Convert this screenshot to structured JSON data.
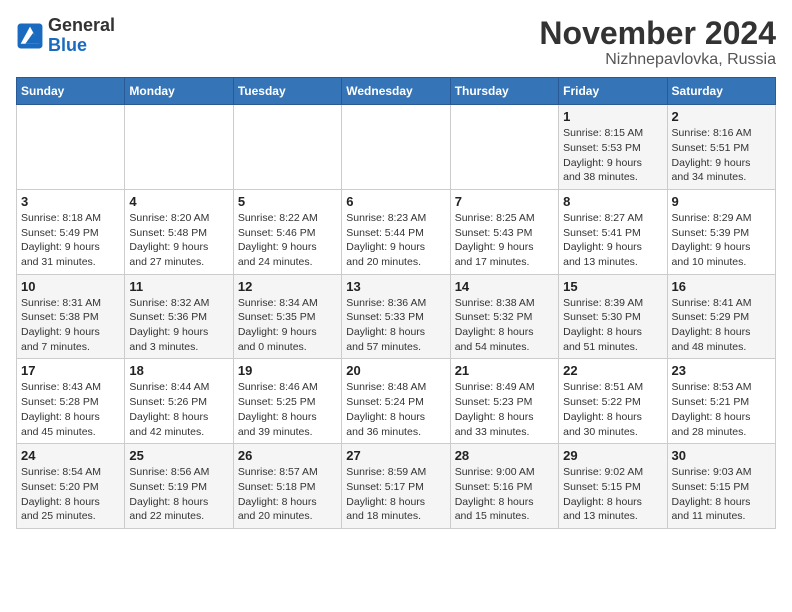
{
  "header": {
    "logo": {
      "general": "General",
      "blue": "Blue"
    },
    "title": "November 2024",
    "subtitle": "Nizhnepavlovka, Russia"
  },
  "calendar": {
    "weekdays": [
      "Sunday",
      "Monday",
      "Tuesday",
      "Wednesday",
      "Thursday",
      "Friday",
      "Saturday"
    ],
    "weeks": [
      [
        {
          "day": "",
          "info": ""
        },
        {
          "day": "",
          "info": ""
        },
        {
          "day": "",
          "info": ""
        },
        {
          "day": "",
          "info": ""
        },
        {
          "day": "",
          "info": ""
        },
        {
          "day": "1",
          "info": "Sunrise: 8:15 AM\nSunset: 5:53 PM\nDaylight: 9 hours\nand 38 minutes."
        },
        {
          "day": "2",
          "info": "Sunrise: 8:16 AM\nSunset: 5:51 PM\nDaylight: 9 hours\nand 34 minutes."
        }
      ],
      [
        {
          "day": "3",
          "info": "Sunrise: 8:18 AM\nSunset: 5:49 PM\nDaylight: 9 hours\nand 31 minutes."
        },
        {
          "day": "4",
          "info": "Sunrise: 8:20 AM\nSunset: 5:48 PM\nDaylight: 9 hours\nand 27 minutes."
        },
        {
          "day": "5",
          "info": "Sunrise: 8:22 AM\nSunset: 5:46 PM\nDaylight: 9 hours\nand 24 minutes."
        },
        {
          "day": "6",
          "info": "Sunrise: 8:23 AM\nSunset: 5:44 PM\nDaylight: 9 hours\nand 20 minutes."
        },
        {
          "day": "7",
          "info": "Sunrise: 8:25 AM\nSunset: 5:43 PM\nDaylight: 9 hours\nand 17 minutes."
        },
        {
          "day": "8",
          "info": "Sunrise: 8:27 AM\nSunset: 5:41 PM\nDaylight: 9 hours\nand 13 minutes."
        },
        {
          "day": "9",
          "info": "Sunrise: 8:29 AM\nSunset: 5:39 PM\nDaylight: 9 hours\nand 10 minutes."
        }
      ],
      [
        {
          "day": "10",
          "info": "Sunrise: 8:31 AM\nSunset: 5:38 PM\nDaylight: 9 hours\nand 7 minutes."
        },
        {
          "day": "11",
          "info": "Sunrise: 8:32 AM\nSunset: 5:36 PM\nDaylight: 9 hours\nand 3 minutes."
        },
        {
          "day": "12",
          "info": "Sunrise: 8:34 AM\nSunset: 5:35 PM\nDaylight: 9 hours\nand 0 minutes."
        },
        {
          "day": "13",
          "info": "Sunrise: 8:36 AM\nSunset: 5:33 PM\nDaylight: 8 hours\nand 57 minutes."
        },
        {
          "day": "14",
          "info": "Sunrise: 8:38 AM\nSunset: 5:32 PM\nDaylight: 8 hours\nand 54 minutes."
        },
        {
          "day": "15",
          "info": "Sunrise: 8:39 AM\nSunset: 5:30 PM\nDaylight: 8 hours\nand 51 minutes."
        },
        {
          "day": "16",
          "info": "Sunrise: 8:41 AM\nSunset: 5:29 PM\nDaylight: 8 hours\nand 48 minutes."
        }
      ],
      [
        {
          "day": "17",
          "info": "Sunrise: 8:43 AM\nSunset: 5:28 PM\nDaylight: 8 hours\nand 45 minutes."
        },
        {
          "day": "18",
          "info": "Sunrise: 8:44 AM\nSunset: 5:26 PM\nDaylight: 8 hours\nand 42 minutes."
        },
        {
          "day": "19",
          "info": "Sunrise: 8:46 AM\nSunset: 5:25 PM\nDaylight: 8 hours\nand 39 minutes."
        },
        {
          "day": "20",
          "info": "Sunrise: 8:48 AM\nSunset: 5:24 PM\nDaylight: 8 hours\nand 36 minutes."
        },
        {
          "day": "21",
          "info": "Sunrise: 8:49 AM\nSunset: 5:23 PM\nDaylight: 8 hours\nand 33 minutes."
        },
        {
          "day": "22",
          "info": "Sunrise: 8:51 AM\nSunset: 5:22 PM\nDaylight: 8 hours\nand 30 minutes."
        },
        {
          "day": "23",
          "info": "Sunrise: 8:53 AM\nSunset: 5:21 PM\nDaylight: 8 hours\nand 28 minutes."
        }
      ],
      [
        {
          "day": "24",
          "info": "Sunrise: 8:54 AM\nSunset: 5:20 PM\nDaylight: 8 hours\nand 25 minutes."
        },
        {
          "day": "25",
          "info": "Sunrise: 8:56 AM\nSunset: 5:19 PM\nDaylight: 8 hours\nand 22 minutes."
        },
        {
          "day": "26",
          "info": "Sunrise: 8:57 AM\nSunset: 5:18 PM\nDaylight: 8 hours\nand 20 minutes."
        },
        {
          "day": "27",
          "info": "Sunrise: 8:59 AM\nSunset: 5:17 PM\nDaylight: 8 hours\nand 18 minutes."
        },
        {
          "day": "28",
          "info": "Sunrise: 9:00 AM\nSunset: 5:16 PM\nDaylight: 8 hours\nand 15 minutes."
        },
        {
          "day": "29",
          "info": "Sunrise: 9:02 AM\nSunset: 5:15 PM\nDaylight: 8 hours\nand 13 minutes."
        },
        {
          "day": "30",
          "info": "Sunrise: 9:03 AM\nSunset: 5:15 PM\nDaylight: 8 hours\nand 11 minutes."
        }
      ]
    ]
  }
}
